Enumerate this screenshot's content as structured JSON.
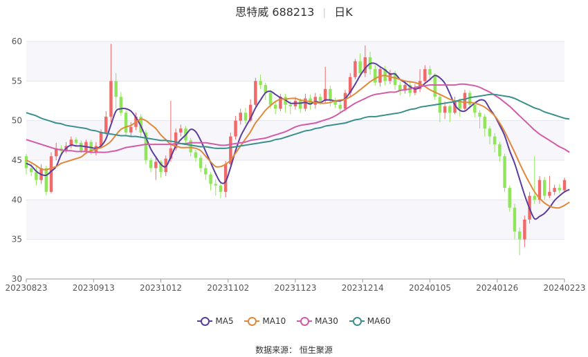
{
  "title": {
    "name": "思特威 688213",
    "period": "日K"
  },
  "legend": [
    {
      "name": "MA5",
      "color": "#5b3c9c"
    },
    {
      "name": "MA10",
      "color": "#e0883a"
    },
    {
      "name": "MA30",
      "color": "#d35aa8"
    },
    {
      "name": "MA60",
      "color": "#3a8f8c"
    }
  ],
  "source": "数据来源： 恒生聚源",
  "chart_data": {
    "type": "candlestick",
    "ylim": [
      30,
      60
    ],
    "yticks": [
      30,
      35,
      40,
      45,
      50,
      55,
      60
    ],
    "xticks": [
      "20230823",
      "20230913",
      "20231012",
      "20231102",
      "20231123",
      "20231214",
      "20240105",
      "20240126",
      "20240223"
    ],
    "colors": {
      "up": "#f06a6a",
      "down": "#8fe65a"
    },
    "grid": true,
    "candles": [
      [
        45.5,
        44.0,
        45.8,
        43.2
      ],
      [
        44.0,
        43.5,
        44.6,
        43.0
      ],
      [
        43.5,
        42.5,
        44.2,
        41.8
      ],
      [
        42.5,
        44.0,
        44.5,
        42.0
      ],
      [
        44.0,
        41.0,
        44.3,
        40.6
      ],
      [
        41.0,
        45.5,
        46.0,
        40.8
      ],
      [
        45.5,
        46.5,
        47.2,
        45.0
      ],
      [
        46.5,
        46.2,
        46.9,
        45.8
      ],
      [
        46.2,
        46.8,
        47.3,
        45.9
      ],
      [
        46.8,
        47.6,
        48.0,
        46.5
      ],
      [
        47.6,
        47.2,
        47.9,
        46.8
      ],
      [
        47.2,
        46.2,
        47.5,
        45.9
      ],
      [
        46.2,
        47.3,
        47.6,
        45.8
      ],
      [
        47.3,
        46.0,
        47.6,
        45.7
      ],
      [
        46.0,
        46.8,
        47.3,
        45.6
      ],
      [
        46.8,
        48.5,
        48.9,
        46.5
      ],
      [
        48.5,
        50.5,
        51.2,
        48.2
      ],
      [
        50.5,
        55.0,
        59.7,
        49.8
      ],
      [
        55.0,
        53.0,
        56.0,
        51.5
      ],
      [
        53.0,
        51.0,
        53.6,
        50.6
      ],
      [
        51.0,
        48.5,
        51.3,
        48.0
      ],
      [
        48.5,
        49.2,
        49.8,
        48.0
      ],
      [
        49.2,
        50.5,
        51.0,
        48.8
      ],
      [
        50.5,
        48.5,
        50.8,
        47.9
      ],
      [
        48.5,
        45.0,
        48.8,
        44.5
      ],
      [
        45.0,
        44.0,
        45.3,
        43.5
      ],
      [
        44.0,
        44.8,
        45.3,
        42.5
      ],
      [
        44.8,
        43.5,
        45.0,
        42.8
      ],
      [
        43.5,
        45.2,
        45.6,
        43.0
      ],
      [
        45.2,
        46.5,
        52.5,
        44.8
      ],
      [
        46.5,
        48.5,
        49.0,
        46.2
      ],
      [
        48.5,
        49.0,
        49.5,
        48.0
      ],
      [
        49.0,
        47.5,
        49.3,
        47.0
      ],
      [
        47.5,
        46.0,
        47.8,
        45.5
      ],
      [
        46.0,
        45.3,
        46.3,
        44.8
      ],
      [
        45.3,
        44.0,
        45.6,
        43.5
      ],
      [
        44.0,
        43.2,
        44.5,
        42.5
      ],
      [
        43.2,
        42.0,
        43.5,
        41.2
      ],
      [
        42.0,
        41.8,
        42.6,
        40.5
      ],
      [
        41.8,
        41.0,
        42.1,
        40.2
      ],
      [
        41.0,
        44.5,
        44.9,
        40.3
      ],
      [
        44.5,
        48.0,
        48.5,
        44.2
      ],
      [
        48.0,
        50.0,
        50.6,
        47.6
      ],
      [
        50.0,
        51.0,
        51.5,
        49.5
      ],
      [
        51.0,
        50.0,
        51.6,
        49.6
      ],
      [
        50.0,
        52.0,
        52.7,
        49.8
      ],
      [
        52.0,
        55.0,
        55.4,
        51.8
      ],
      [
        55.0,
        54.5,
        55.8,
        54.0
      ],
      [
        54.5,
        53.5,
        54.8,
        52.6
      ],
      [
        53.5,
        52.0,
        53.9,
        51.5
      ],
      [
        52.0,
        51.5,
        52.5,
        50.8
      ],
      [
        51.5,
        53.0,
        53.4,
        51.2
      ],
      [
        53.0,
        52.0,
        53.4,
        51.0
      ],
      [
        52.0,
        51.8,
        52.5,
        50.8
      ],
      [
        51.8,
        52.5,
        53.0,
        51.4
      ],
      [
        52.5,
        51.5,
        52.8,
        51.0
      ],
      [
        51.5,
        52.8,
        53.4,
        51.2
      ],
      [
        52.8,
        52.0,
        53.3,
        51.4
      ],
      [
        52.0,
        53.0,
        53.5,
        51.5
      ],
      [
        53.0,
        52.5,
        53.4,
        52.0
      ],
      [
        52.5,
        54.0,
        56.8,
        52.2
      ],
      [
        54.0,
        52.5,
        54.4,
        51.8
      ],
      [
        52.5,
        52.0,
        52.9,
        51.6
      ],
      [
        52.0,
        51.5,
        52.4,
        50.9
      ],
      [
        51.5,
        53.5,
        53.9,
        51.2
      ],
      [
        53.5,
        55.5,
        56.0,
        53.0
      ],
      [
        55.5,
        57.5,
        57.8,
        55.2
      ],
      [
        57.5,
        56.0,
        58.5,
        55.5
      ],
      [
        56.0,
        58.0,
        59.5,
        55.5
      ],
      [
        58.0,
        56.5,
        58.7,
        55.8
      ],
      [
        56.5,
        54.8,
        57.0,
        54.4
      ],
      [
        54.8,
        56.5,
        56.9,
        54.3
      ],
      [
        56.5,
        55.0,
        56.9,
        54.5
      ],
      [
        55.0,
        56.0,
        56.4,
        54.6
      ],
      [
        56.0,
        54.5,
        56.3,
        53.9
      ],
      [
        54.5,
        53.8,
        54.9,
        53.2
      ],
      [
        53.8,
        54.5,
        55.0,
        53.4
      ],
      [
        54.5,
        53.5,
        54.9,
        53.0
      ],
      [
        53.5,
        54.0,
        54.6,
        53.2
      ],
      [
        54.0,
        55.0,
        56.5,
        53.6
      ],
      [
        55.0,
        56.5,
        57.0,
        54.6
      ],
      [
        56.5,
        55.8,
        56.9,
        55.2
      ],
      [
        55.8,
        53.0,
        56.0,
        52.6
      ],
      [
        53.0,
        51.0,
        53.4,
        49.8
      ],
      [
        51.0,
        51.8,
        52.4,
        50.2
      ],
      [
        51.8,
        51.0,
        52.0,
        49.8
      ],
      [
        51.0,
        52.5,
        53.0,
        50.8
      ],
      [
        52.5,
        51.5,
        52.8,
        50.5
      ],
      [
        51.5,
        53.5,
        53.9,
        51.2
      ],
      [
        53.5,
        52.0,
        53.8,
        51.5
      ],
      [
        52.0,
        51.0,
        52.4,
        50.4
      ],
      [
        51.0,
        50.5,
        51.3,
        49.0
      ],
      [
        50.5,
        49.0,
        50.8,
        48.0
      ],
      [
        49.0,
        48.0,
        49.3,
        47.0
      ],
      [
        48.0,
        47.0,
        48.4,
        46.0
      ],
      [
        47.0,
        45.5,
        47.3,
        44.8
      ],
      [
        45.5,
        41.5,
        45.8,
        41.0
      ],
      [
        41.5,
        39.0,
        41.8,
        38.5
      ],
      [
        39.0,
        36.0,
        39.5,
        35.0
      ],
      [
        36.0,
        35.0,
        36.5,
        33.0
      ],
      [
        35.0,
        37.5,
        38.0,
        34.0
      ],
      [
        37.5,
        40.5,
        41.0,
        37.0
      ],
      [
        40.5,
        40.0,
        45.5,
        39.5
      ],
      [
        40.0,
        42.5,
        43.0,
        39.5
      ],
      [
        42.5,
        40.5,
        42.9,
        40.0
      ],
      [
        40.5,
        41.0,
        43.0,
        40.2
      ],
      [
        41.0,
        41.5,
        41.9,
        40.6
      ],
      [
        41.5,
        41.2,
        42.0,
        40.8
      ],
      [
        41.2,
        42.5,
        42.8,
        40.9
      ]
    ],
    "ma5": [
      44.6,
      44.3,
      43.6,
      43.2,
      43.1,
      43.6,
      44.2,
      45.7,
      46.5,
      46.9,
      46.8,
      46.8,
      46.7,
      46.6,
      46.5,
      46.8,
      47.7,
      49.5,
      51.2,
      51.5,
      51.5,
      51.2,
      50.4,
      49.3,
      47.9,
      46.4,
      45.4,
      44.5,
      44.2,
      45.4,
      46.8,
      47.6,
      48.2,
      48.9,
      48.6,
      47.5,
      46.1,
      44.7,
      43.3,
      42.2,
      42.3,
      44.1,
      46.2,
      48.0,
      49.2,
      50.3,
      51.6,
      52.6,
      53.5,
      53.7,
      53.3,
      52.9,
      52.6,
      52.2,
      52.2,
      52.2,
      52.3,
      52.1,
      52.4,
      52.3,
      52.6,
      52.6,
      52.5,
      52.5,
      52.8,
      53.6,
      54.6,
      55.7,
      56.6,
      57.2,
      57.2,
      56.8,
      56.4,
      55.9,
      55.9,
      55.2,
      54.8,
      54.3,
      54.0,
      54.2,
      54.7,
      55.2,
      55.7,
      55.4,
      54.7,
      53.4,
      52.0,
      51.3,
      51.2,
      51.7,
      52.2,
      52.6,
      52.5,
      51.5,
      50.6,
      49.4,
      48.1,
      46.2,
      44.6,
      42.6,
      40.6,
      38.9,
      37.6,
      37.9,
      38.3,
      39.0,
      39.9,
      40.5,
      41.0,
      41.3
    ],
    "ma10": [
      45.0,
      44.7,
      44.3,
      43.9,
      43.8,
      44.0,
      44.2,
      44.6,
      44.8,
      45.0,
      45.2,
      45.4,
      45.9,
      46.2,
      46.4,
      46.6,
      46.9,
      47.4,
      48.2,
      48.9,
      49.2,
      49.4,
      49.8,
      50.2,
      50.0,
      49.5,
      49.0,
      48.2,
      47.6,
      47.0,
      46.8,
      46.6,
      46.6,
      46.6,
      46.5,
      46.2,
      45.5,
      44.8,
      44.2,
      44.2,
      44.5,
      45.0,
      45.9,
      46.8,
      47.7,
      48.6,
      49.7,
      50.5,
      51.3,
      51.9,
      52.4,
      52.7,
      52.7,
      52.8,
      52.8,
      52.6,
      52.5,
      52.4,
      52.3,
      52.2,
      52.2,
      52.3,
      52.5,
      52.6,
      52.7,
      53.0,
      53.4,
      53.9,
      54.4,
      54.9,
      55.3,
      55.6,
      55.7,
      55.5,
      55.4,
      55.2,
      55.0,
      54.9,
      54.8,
      54.6,
      54.3,
      53.9,
      53.6,
      53.3,
      53.0,
      52.7,
      52.5,
      52.4,
      52.3,
      52.3,
      52.2,
      52.0,
      51.7,
      51.2,
      50.6,
      49.7,
      48.6,
      47.3,
      46.0,
      44.6,
      43.3,
      42.1,
      41.0,
      40.2,
      39.6,
      39.2,
      39.0,
      39.0,
      39.3,
      39.7
    ],
    "ma30": [
      47.6,
      47.4,
      47.2,
      47.0,
      46.8,
      46.6,
      46.4,
      46.3,
      46.2,
      46.2,
      46.1,
      46.1,
      46.1,
      46.0,
      46.0,
      46.0,
      46.0,
      46.1,
      46.2,
      46.4,
      46.6,
      46.7,
      46.8,
      46.9,
      47.0,
      47.0,
      47.0,
      47.0,
      47.0,
      47.0,
      47.1,
      47.1,
      47.1,
      47.2,
      47.2,
      47.2,
      47.2,
      47.1,
      47.0,
      46.9,
      46.9,
      47.0,
      47.1,
      47.2,
      47.3,
      47.5,
      47.6,
      47.7,
      47.8,
      48.0,
      48.2,
      48.4,
      48.6,
      48.9,
      49.2,
      49.4,
      49.5,
      49.6,
      49.7,
      49.9,
      50.1,
      50.3,
      50.6,
      51.0,
      51.4,
      51.8,
      52.2,
      52.5,
      52.8,
      53.1,
      53.3,
      53.4,
      53.5,
      53.6,
      53.6,
      53.8,
      53.9,
      54.0,
      54.2,
      54.3,
      54.4,
      54.5,
      54.5,
      54.5,
      54.5,
      54.5,
      54.5,
      54.6,
      54.6,
      54.5,
      54.4,
      54.2,
      53.9,
      53.6,
      53.2,
      52.8,
      52.3,
      51.8,
      51.2,
      50.6,
      50.0,
      49.4,
      48.8,
      48.3,
      47.9,
      47.5,
      47.1,
      46.7,
      46.4,
      46.0
    ],
    "ma60": [
      51.0,
      50.8,
      50.6,
      50.3,
      50.1,
      49.9,
      49.7,
      49.6,
      49.4,
      49.3,
      49.2,
      49.1,
      49.0,
      48.8,
      48.7,
      48.5,
      48.4,
      48.3,
      48.2,
      48.1,
      48.1,
      48.0,
      48.0,
      47.9,
      47.8,
      47.7,
      47.6,
      47.5,
      47.5,
      47.4,
      47.3,
      47.1,
      47.0,
      46.9,
      46.8,
      46.7,
      46.7,
      46.6,
      46.5,
      46.5,
      46.5,
      46.6,
      46.7,
      46.8,
      46.9,
      47.0,
      47.1,
      47.2,
      47.3,
      47.4,
      47.6,
      47.7,
      47.9,
      48.1,
      48.3,
      48.5,
      48.7,
      48.8,
      49.0,
      49.1,
      49.3,
      49.4,
      49.5,
      49.6,
      49.7,
      49.9,
      50.1,
      50.2,
      50.4,
      50.5,
      50.5,
      50.6,
      50.7,
      50.8,
      50.9,
      51.0,
      51.2,
      51.4,
      51.5,
      51.7,
      51.8,
      51.9,
      52.0,
      52.1,
      52.2,
      52.3,
      52.4,
      52.6,
      52.7,
      52.9,
      53.0,
      53.1,
      53.2,
      53.3,
      53.3,
      53.2,
      53.1,
      53.0,
      52.8,
      52.5,
      52.2,
      51.9,
      51.6,
      51.4,
      51.1,
      50.9,
      50.7,
      50.5,
      50.3,
      50.2
    ]
  }
}
